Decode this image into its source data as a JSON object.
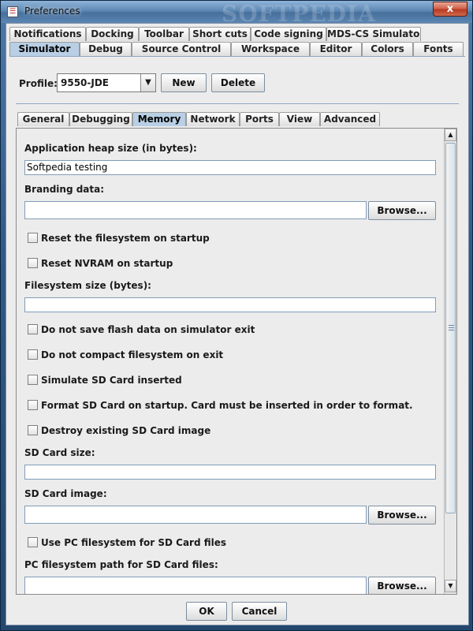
{
  "window": {
    "title": "Preferences",
    "close_label": "x",
    "watermark": "SOFTPEDIA"
  },
  "outer_tabs_row1": [
    {
      "label": "Notifications"
    },
    {
      "label": "Docking"
    },
    {
      "label": "Toolbar"
    },
    {
      "label": "Short cuts"
    },
    {
      "label": "Code signing"
    },
    {
      "label": "MDS-CS Simulator"
    }
  ],
  "outer_tabs_row2": [
    {
      "label": "Simulator",
      "active": true
    },
    {
      "label": "Debug"
    },
    {
      "label": "Source Control"
    },
    {
      "label": "Workspace"
    },
    {
      "label": "Editor"
    },
    {
      "label": "Colors"
    },
    {
      "label": "Fonts"
    }
  ],
  "profile": {
    "label": "Profile:",
    "value": "9550-JDE",
    "new_label": "New",
    "delete_label": "Delete"
  },
  "inner_tabs": [
    {
      "label": "General"
    },
    {
      "label": "Debugging"
    },
    {
      "label": "Memory",
      "active": true
    },
    {
      "label": "Network"
    },
    {
      "label": "Ports"
    },
    {
      "label": "View"
    },
    {
      "label": "Advanced"
    }
  ],
  "memory": {
    "heap_label": "Application heap size (in bytes):",
    "heap_value": "Softpedia testing",
    "branding_label": "Branding data:",
    "branding_value": "",
    "browse_label": "Browse...",
    "reset_fs_label": "Reset the filesystem on startup",
    "reset_nvram_label": "Reset NVRAM on startup",
    "fs_size_label": "Filesystem size (bytes):",
    "fs_size_value": "",
    "no_save_flash_label": "Do not save flash data on simulator exit",
    "no_compact_label": "Do not compact filesystem on exit",
    "simulate_sd_label": "Simulate SD Card inserted",
    "format_sd_label": "Format SD Card on startup. Card must be inserted in order to format.",
    "destroy_sd_label": "Destroy existing SD Card image",
    "sd_size_label": "SD Card size:",
    "sd_size_value": "",
    "sd_image_label": "SD Card image:",
    "sd_image_value": "",
    "use_pc_fs_label": "Use PC filesystem for SD Card files",
    "pc_fs_path_label": "PC filesystem path for SD Card files:",
    "pc_fs_path_value": ""
  },
  "footer": {
    "ok_label": "OK",
    "cancel_label": "Cancel"
  }
}
